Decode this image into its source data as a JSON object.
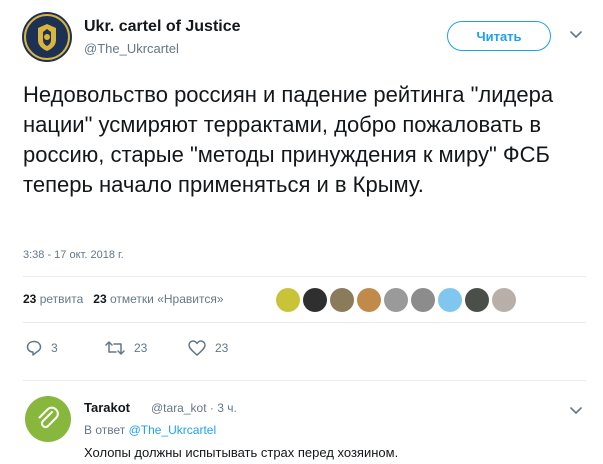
{
  "tweet": {
    "author_name": "Ukr. cartel of Justice",
    "author_handle": "@The_Ukrcartel",
    "follow_label": "Читать",
    "text": "Недовольство россиян и падение рейтинга \"лидера нации\" усмиряют терр­актами, добро пожаловать в россию, старые \"методы принуждения к миру\" ФСБ теперь начало применяться и в Крыму.",
    "timestamp": "3:38 - 17 окт. 2018 г.",
    "stats": {
      "retweets_count": "23",
      "retweets_label": "ретвита",
      "likes_count": "23",
      "likes_label": "отметки «Нравится»"
    },
    "actions": {
      "reply_count": "3",
      "retweet_count": "23",
      "like_count": "23"
    },
    "liker_colors": [
      "#c9c33a",
      "#2f2f2f",
      "#8a7b5a",
      "#c08a4a",
      "#9a9a9a",
      "#8c8c8c",
      "#7fc7ef",
      "#4a4f4a",
      "#b8b0a8"
    ]
  },
  "reply": {
    "author_name": "Tarakot",
    "author_handle": "@tara_kot",
    "separator": "·",
    "time": "3 ч.",
    "in_reply_prefix": "В ответ",
    "in_reply_handle": "@The_Ukrcartel",
    "text": "Холопы должны испытывать страх перед хозяином."
  },
  "colors": {
    "accent": "#1da1f2",
    "secondary_text": "#657786",
    "divider": "#e6ecf0"
  }
}
